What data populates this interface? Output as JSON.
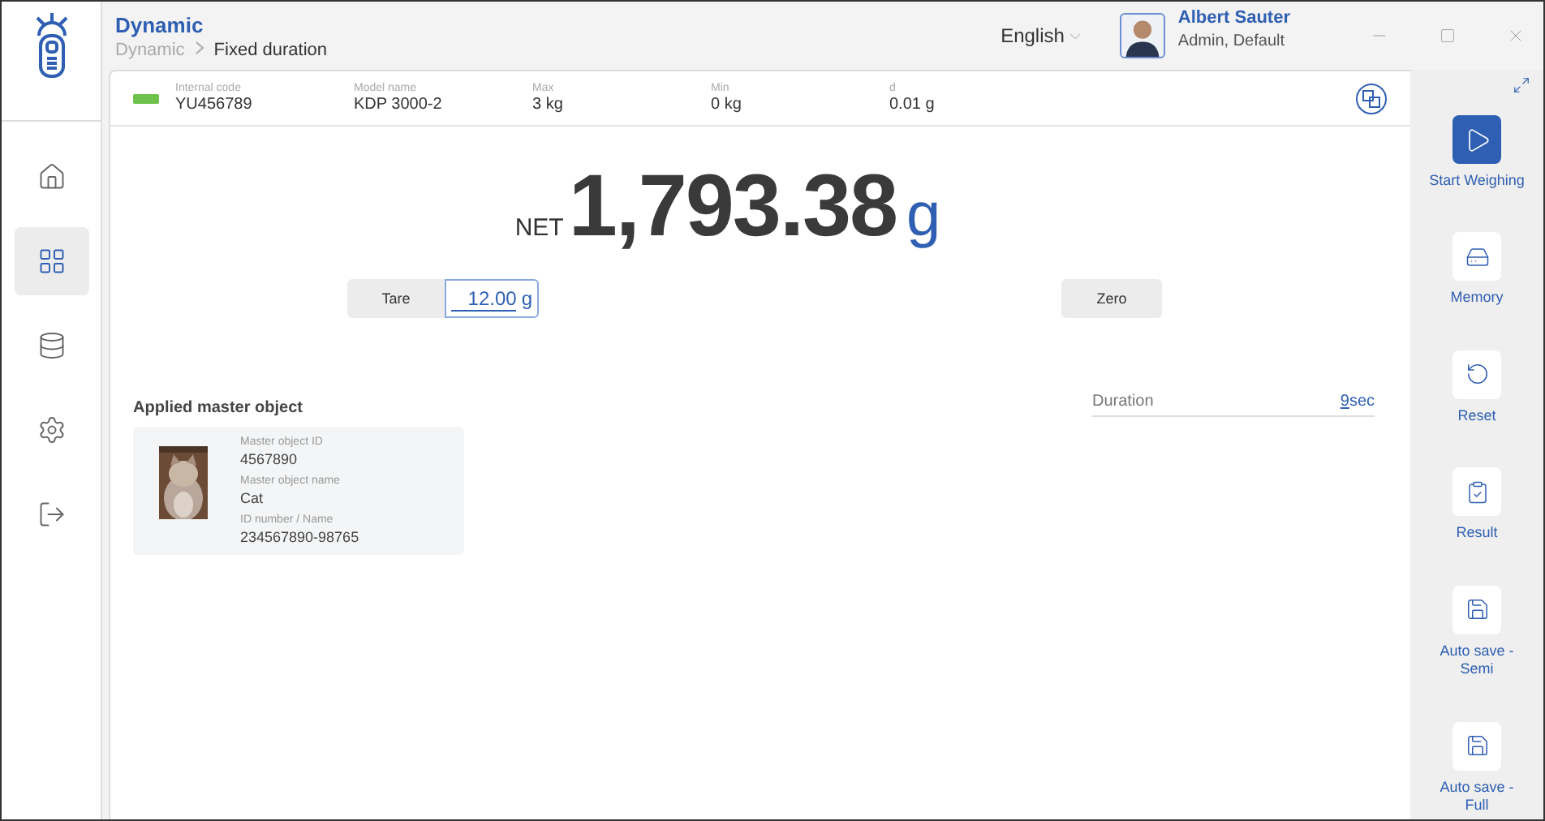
{
  "app": {
    "title": "Dynamic",
    "breadcrumb": [
      {
        "label": "Dynamic",
        "current": false
      },
      {
        "label": "Fixed duration",
        "current": true
      }
    ]
  },
  "language": "English",
  "user": {
    "name": "Albert Sauter",
    "role": "Admin, Default"
  },
  "nav": [
    {
      "kind": "home",
      "selected": false
    },
    {
      "kind": "apps",
      "selected": true
    },
    {
      "kind": "database",
      "selected": false
    },
    {
      "kind": "settings",
      "selected": false
    },
    {
      "kind": "logout",
      "selected": false
    }
  ],
  "scale_info": [
    {
      "label": "Internal code",
      "value": "YU456789"
    },
    {
      "label": "Model name",
      "value": "KDP 3000-2"
    },
    {
      "label": "Max",
      "value": "3 kg"
    },
    {
      "label": "Min",
      "value": "0 kg"
    },
    {
      "label": "d",
      "value": "0.01 g"
    }
  ],
  "weight": {
    "prefix": "NET",
    "value": "1,793.38",
    "unit": "g"
  },
  "tare": {
    "label": "Tare",
    "value": "12.00",
    "unit": "g"
  },
  "zero": {
    "label": "Zero"
  },
  "master": {
    "title": "Applied master object",
    "fields": [
      {
        "label": "Master object ID",
        "value": "4567890"
      },
      {
        "label": "Master object name",
        "value": "Cat"
      },
      {
        "label": "ID number / Name",
        "value": "234567890-98765"
      }
    ]
  },
  "duration": {
    "label": "Duration",
    "value": "9",
    "unit": "sec"
  },
  "actions": [
    {
      "kind": "start",
      "label": "Start Weighing",
      "primary": true
    },
    {
      "kind": "memory",
      "label": "Memory",
      "primary": false
    },
    {
      "kind": "reset",
      "label": "Reset",
      "primary": false
    },
    {
      "kind": "result",
      "label": "Result",
      "primary": false
    },
    {
      "kind": "save",
      "label": "Auto save - Semi",
      "primary": false
    },
    {
      "kind": "save",
      "label": "Auto save - Full",
      "primary": false
    }
  ]
}
